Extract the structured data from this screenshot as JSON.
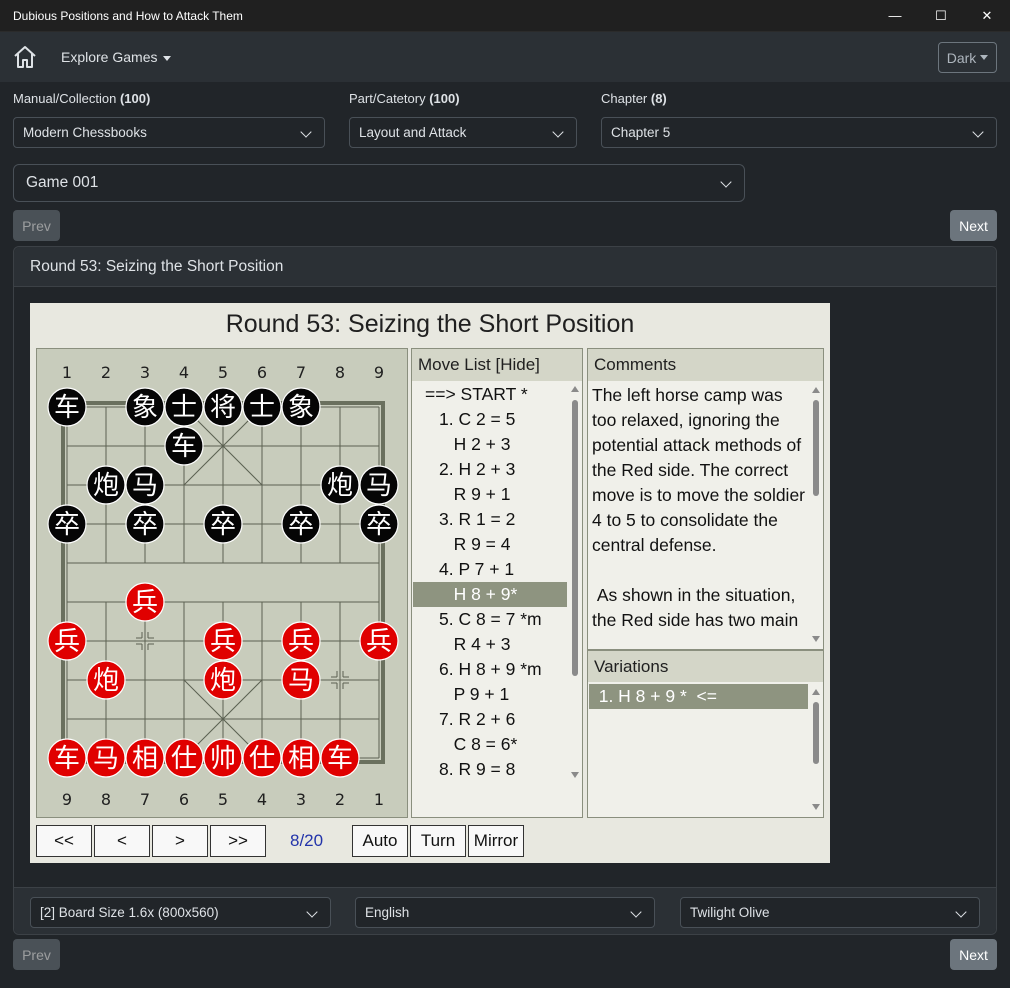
{
  "window": {
    "title": "Dubious Positions and How to Attack Them",
    "minimize": "—",
    "maximize": "☐",
    "close": "✕"
  },
  "nav": {
    "home_icon": "home-icon",
    "explore": "Explore Games",
    "theme": "Dark"
  },
  "filters": {
    "manual_label": "Manual/Collection ",
    "manual_count": "(100)",
    "manual_value": "Modern Chessbooks",
    "part_label": "Part/Catetory ",
    "part_count": "(100)",
    "part_value": "Layout and Attack",
    "chapter_label": "Chapter ",
    "chapter_count": "(8)",
    "chapter_value": "Chapter 5",
    "game_value": "Game 001"
  },
  "pager": {
    "prev": "Prev",
    "next": "Next"
  },
  "card": {
    "header": "Round 53: Seizing the Short Position"
  },
  "viewer": {
    "title": "Round 53: Seizing the Short Position",
    "file_labels_top": [
      "1",
      "2",
      "3",
      "4",
      "5",
      "6",
      "7",
      "8",
      "9"
    ],
    "file_labels_bottom": [
      "9",
      "8",
      "7",
      "6",
      "5",
      "4",
      "3",
      "2",
      "1"
    ],
    "pieces": [
      {
        "ch": "车",
        "side": "black",
        "file": 0,
        "rank": 0
      },
      {
        "ch": "象",
        "side": "black",
        "file": 2,
        "rank": 0
      },
      {
        "ch": "士",
        "side": "black",
        "file": 3,
        "rank": 0
      },
      {
        "ch": "将",
        "side": "black",
        "file": 4,
        "rank": 0
      },
      {
        "ch": "士",
        "side": "black",
        "file": 5,
        "rank": 0
      },
      {
        "ch": "象",
        "side": "black",
        "file": 6,
        "rank": 0
      },
      {
        "ch": "车",
        "side": "black",
        "file": 3,
        "rank": 1
      },
      {
        "ch": "炮",
        "side": "black",
        "file": 1,
        "rank": 2
      },
      {
        "ch": "马",
        "side": "black",
        "file": 2,
        "rank": 2
      },
      {
        "ch": "炮",
        "side": "black",
        "file": 7,
        "rank": 2
      },
      {
        "ch": "马",
        "side": "black",
        "file": 8,
        "rank": 2
      },
      {
        "ch": "卒",
        "side": "black",
        "file": 0,
        "rank": 3
      },
      {
        "ch": "卒",
        "side": "black",
        "file": 2,
        "rank": 3
      },
      {
        "ch": "卒",
        "side": "black",
        "file": 4,
        "rank": 3
      },
      {
        "ch": "卒",
        "side": "black",
        "file": 6,
        "rank": 3
      },
      {
        "ch": "卒",
        "side": "black",
        "file": 8,
        "rank": 3
      },
      {
        "ch": "兵",
        "side": "red",
        "file": 2,
        "rank": 5
      },
      {
        "ch": "兵",
        "side": "red",
        "file": 0,
        "rank": 6
      },
      {
        "ch": "兵",
        "side": "red",
        "file": 4,
        "rank": 6
      },
      {
        "ch": "兵",
        "side": "red",
        "file": 6,
        "rank": 6
      },
      {
        "ch": "兵",
        "side": "red",
        "file": 8,
        "rank": 6
      },
      {
        "ch": "炮",
        "side": "red",
        "file": 1,
        "rank": 7
      },
      {
        "ch": "炮",
        "side": "red",
        "file": 4,
        "rank": 7
      },
      {
        "ch": "马",
        "side": "red",
        "file": 6,
        "rank": 7
      },
      {
        "ch": "车",
        "side": "red",
        "file": 0,
        "rank": 9
      },
      {
        "ch": "马",
        "side": "red",
        "file": 1,
        "rank": 9
      },
      {
        "ch": "相",
        "side": "red",
        "file": 2,
        "rank": 9
      },
      {
        "ch": "仕",
        "side": "red",
        "file": 3,
        "rank": 9
      },
      {
        "ch": "帅",
        "side": "red",
        "file": 4,
        "rank": 9
      },
      {
        "ch": "仕",
        "side": "red",
        "file": 5,
        "rank": 9
      },
      {
        "ch": "相",
        "side": "red",
        "file": 6,
        "rank": 9
      },
      {
        "ch": "车",
        "side": "red",
        "file": 7,
        "rank": 9
      }
    ],
    "move_list_header": "Move List [Hide]",
    "moves": [
      "==> START *",
      "1. C 2 = 5",
      "   H 2 + 3",
      "2. H 2 + 3",
      "   R 9 + 1",
      "3. R 1 = 2",
      "   R 9 = 4",
      "4. P 7 + 1",
      "   H 8 + 9*",
      "5. C 8 = 7 *m",
      "   R 4 + 3",
      "6. H 8 + 9 *m",
      "   P 9 + 1",
      "7. R 2 + 6",
      "   C 8 = 6*",
      "8. R 9 = 8"
    ],
    "selected_move": 8,
    "comments_header": "Comments",
    "comments": "The left horse camp was too relaxed, ignoring the potential attack methods of the Red side. The correct move is to move the soldier 4 to 5 to consolidate the central defense.\n\n As shown in the situation, the Red side has two main",
    "variations_header": "Variations",
    "variation": "  1. H 8 + 9 *  <=",
    "controls": {
      "first": "<<",
      "prev": "<",
      "next": ">",
      "last": ">>",
      "counter": "8/20",
      "auto": "Auto",
      "turn": "Turn",
      "mirror": "Mirror"
    }
  },
  "footer": {
    "board_size": "[2] Board Size 1.6x (800x560)",
    "language": "English",
    "theme": "Twilight Olive"
  }
}
